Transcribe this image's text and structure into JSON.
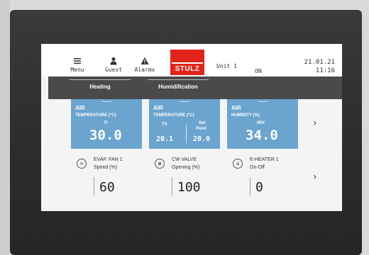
{
  "header": {
    "menu_label": "Menu",
    "guest_label": "Guest",
    "alarms_label": "Alarms",
    "logo_text": "STULZ",
    "unit": "Unit 1",
    "state": "ON",
    "date": "21.01.21",
    "time": "11:16"
  },
  "modes": [
    {
      "label": "Heating"
    },
    {
      "label": "Humidification"
    }
  ],
  "tiles": [
    {
      "title": "AIR",
      "subtitle": "TEMPERATURE (°C)",
      "tag": "TI",
      "value": "30.0"
    },
    {
      "title": "AIR",
      "subtitle": "TEMPERATURE (°C)",
      "tag_left": "TS",
      "tag_right_1": "Set",
      "tag_right_2": "Point",
      "value_left": "20.1",
      "value_right": "20.0"
    },
    {
      "title": "AIR",
      "subtitle": "HUMIDITY (%)",
      "tag": "tRH",
      "value": "34.0"
    }
  ],
  "status_items": [
    {
      "icon": "fan-icon",
      "icon_text": "✲",
      "label1": "EVAP. FAN 1",
      "label2": "Speed (%)",
      "value": "60"
    },
    {
      "icon": "valve-icon",
      "icon_text": "⊠",
      "label1": "CW VALVE",
      "label2": "Opening (%)",
      "value": "100"
    },
    {
      "icon": "heater-icon",
      "icon_text": "≡",
      "label1": "E-HEATER 1",
      "label2": "On-Off",
      "value": "0"
    }
  ],
  "nav": {
    "next_glyph": "›"
  },
  "colors": {
    "tile_blue": "#6aa4cf",
    "brand_red": "#e2231a",
    "mode_bar": "#4a4a4a"
  }
}
